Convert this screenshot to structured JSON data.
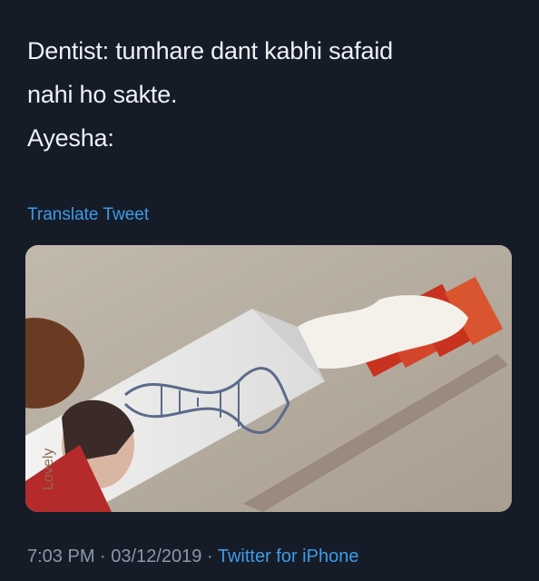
{
  "tweet": {
    "lines": [
      "Dentist: tumhare dant kabhi safaid",
      "nahi ho sakte.",
      "Ayesha:"
    ],
    "translate_label": "Translate Tweet",
    "media": {
      "image_alt": "Fairness cream tube squeezed onto a toothbrush",
      "brand_text": "Lovely"
    },
    "time": "7:03 PM",
    "date": "03/12/2019",
    "separator": "·",
    "source": "Twitter for iPhone"
  },
  "colors": {
    "background": "#151c28",
    "text": "#eef1f5",
    "link": "#3f9be6",
    "meta": "#8b98a6"
  }
}
